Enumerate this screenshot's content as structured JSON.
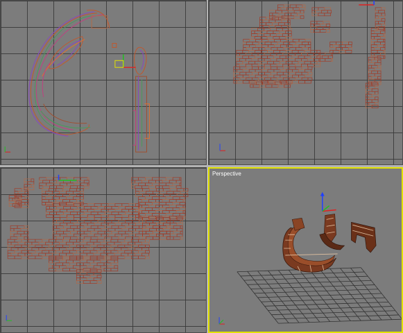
{
  "viewports": {
    "top": {
      "label": ""
    },
    "front": {
      "label": ""
    },
    "left": {
      "label": ""
    },
    "perspective": {
      "label": "Perspective"
    }
  },
  "colors": {
    "viewport_bg": "#7c7c7c",
    "grid_line": "#3a3a3a",
    "active_border": "#e2e200",
    "wire_brick": "#a23a26",
    "wire_brick_alt": "#b06a4a",
    "gizmo_x": "#e02020",
    "gizmo_y": "#20c020",
    "gizmo_z": "#2040ff",
    "solid_model": "#6a3a22"
  },
  "icons": [
    "axis-gizmo-icon",
    "transform-gizmo-icon"
  ]
}
